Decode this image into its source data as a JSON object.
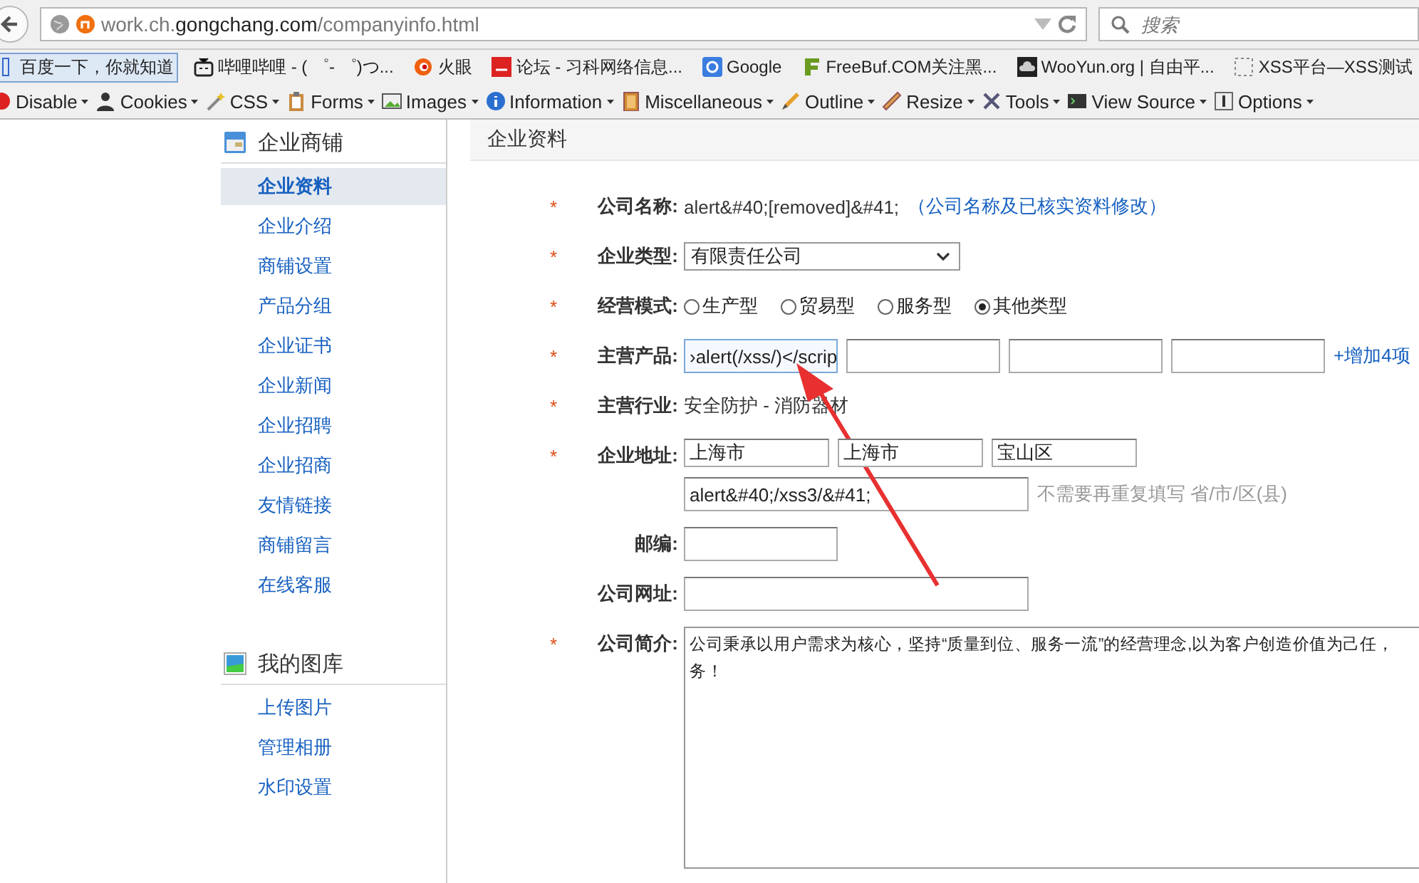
{
  "browser": {
    "url": {
      "prefix": "work.ch.",
      "domain": "gongchang.com",
      "path": "/companyinfo.html"
    },
    "search": {
      "placeholder": "搜索"
    },
    "bookmarks": [
      {
        "label": "百度一下，你就知道",
        "selected": true
      },
      {
        "label": "哔哩哔哩 - ( ゜- ゜)つ...",
        "selected": false
      },
      {
        "label": "火眼",
        "selected": false
      },
      {
        "label": "论坛 - 习科网络信息...",
        "selected": false
      },
      {
        "label": "Google",
        "selected": false
      },
      {
        "label": "FreeBuf.COM关注黑...",
        "selected": false
      },
      {
        "label": "WooYun.org | 自由平...",
        "selected": false
      },
      {
        "label": "XSS平台—XSS测试",
        "selected": false
      }
    ],
    "tools": [
      "Disable",
      "Cookies",
      "CSS",
      "Forms",
      "Images",
      "Information",
      "Miscellaneous",
      "Outline",
      "Resize",
      "Tools",
      "View Source",
      "Options"
    ]
  },
  "sidebar": [
    {
      "title": "企业商铺",
      "items": [
        {
          "label": "企业资料",
          "selected": true
        },
        {
          "label": "企业介绍",
          "selected": false
        },
        {
          "label": "商铺设置",
          "selected": false
        },
        {
          "label": "产品分组",
          "selected": false
        },
        {
          "label": "企业证书",
          "selected": false
        },
        {
          "label": "企业新闻",
          "selected": false
        },
        {
          "label": "企业招聘",
          "selected": false
        },
        {
          "label": "企业招商",
          "selected": false
        },
        {
          "label": "友情链接",
          "selected": false
        },
        {
          "label": "商铺留言",
          "selected": false
        },
        {
          "label": "在线客服",
          "selected": false
        }
      ]
    },
    {
      "title": "我的图库",
      "items": [
        {
          "label": "上传图片",
          "selected": false
        },
        {
          "label": "管理相册",
          "selected": false
        },
        {
          "label": "水印设置",
          "selected": false
        }
      ]
    }
  ],
  "main": {
    "title": "企业资料",
    "fields": [
      {
        "kind": "text",
        "mark": "*",
        "label": "公司名称:",
        "value": "alert&#40;[removed]&#41;",
        "link": "（公司名称及已核实资料修改）"
      },
      {
        "kind": "select",
        "mark": "*",
        "label": "企业类型:",
        "value": "有限责任公司"
      },
      {
        "kind": "radio",
        "mark": "*",
        "label": "经营模式:",
        "options": [
          {
            "label": "生产型",
            "selected": false
          },
          {
            "label": "贸易型",
            "selected": false
          },
          {
            "label": "服务型",
            "selected": false
          },
          {
            "label": "其他类型",
            "selected": true
          }
        ]
      },
      {
        "kind": "multi",
        "mark": "*",
        "label": "主营产品:",
        "values": [
          {
            "value": "›alert(/xss/)</scrip",
            "focused": true
          },
          {
            "focused": false
          },
          {
            "focused": false
          },
          {
            "focused": false
          }
        ],
        "link": "+增加4项"
      },
      {
        "kind": "plain",
        "mark": "*",
        "label": "主营行业:",
        "value": "安全防护 - 消防器材"
      },
      {
        "kind": "address",
        "mark": "*",
        "label": "企业地址:",
        "parts": [
          "上海市",
          "上海市",
          "宝山区"
        ],
        "value": "alert&#40;/xss3/&#41;",
        "hint": "不需要再重复填写 省/市/区(县)"
      },
      {
        "kind": "input",
        "label": "邮编:"
      },
      {
        "kind": "wideinput",
        "label": "公司网址:"
      },
      {
        "kind": "textarea",
        "mark": "*",
        "label": "公司简介:",
        "lines": [
          "公司秉承以用户需求为核心，坚持“质量到位、服务一流”的经营理念,以为客户创造价值为己任，",
          "务！"
        ]
      }
    ]
  }
}
